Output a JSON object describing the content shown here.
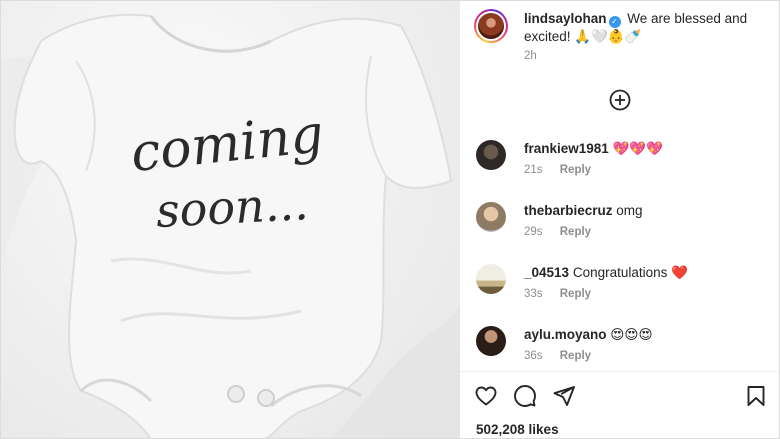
{
  "photo": {
    "text_line1": "coming",
    "text_line2": "soon..."
  },
  "post": {
    "username": "lindsaylohan",
    "caption": "We are blessed and excited! 🙏🤍👶🍼",
    "time": "2h"
  },
  "comments": [
    {
      "username": "frankiew1981",
      "text": "💖💖💖",
      "time": "21s",
      "reply": "Reply"
    },
    {
      "username": "thebarbiecruz",
      "text": "omg",
      "time": "29s",
      "reply": "Reply"
    },
    {
      "username": "_04513",
      "text": "Congratulations ❤️",
      "time": "33s",
      "reply": "Reply"
    },
    {
      "username": "aylu.moyano",
      "text": "😍😍😍",
      "time": "36s",
      "reply": "Reply"
    }
  ],
  "likes": "502,208 likes",
  "icons": {
    "verified": "verified-badge-icon",
    "add": "plus-circle-icon",
    "like": "heart-icon",
    "comment": "comment-bubble-icon",
    "share": "paper-plane-icon",
    "save": "bookmark-icon"
  },
  "colors": {
    "text": "#262626",
    "muted": "#8e8e8e",
    "verified": "#3897f0",
    "border": "#dbdbdb"
  }
}
